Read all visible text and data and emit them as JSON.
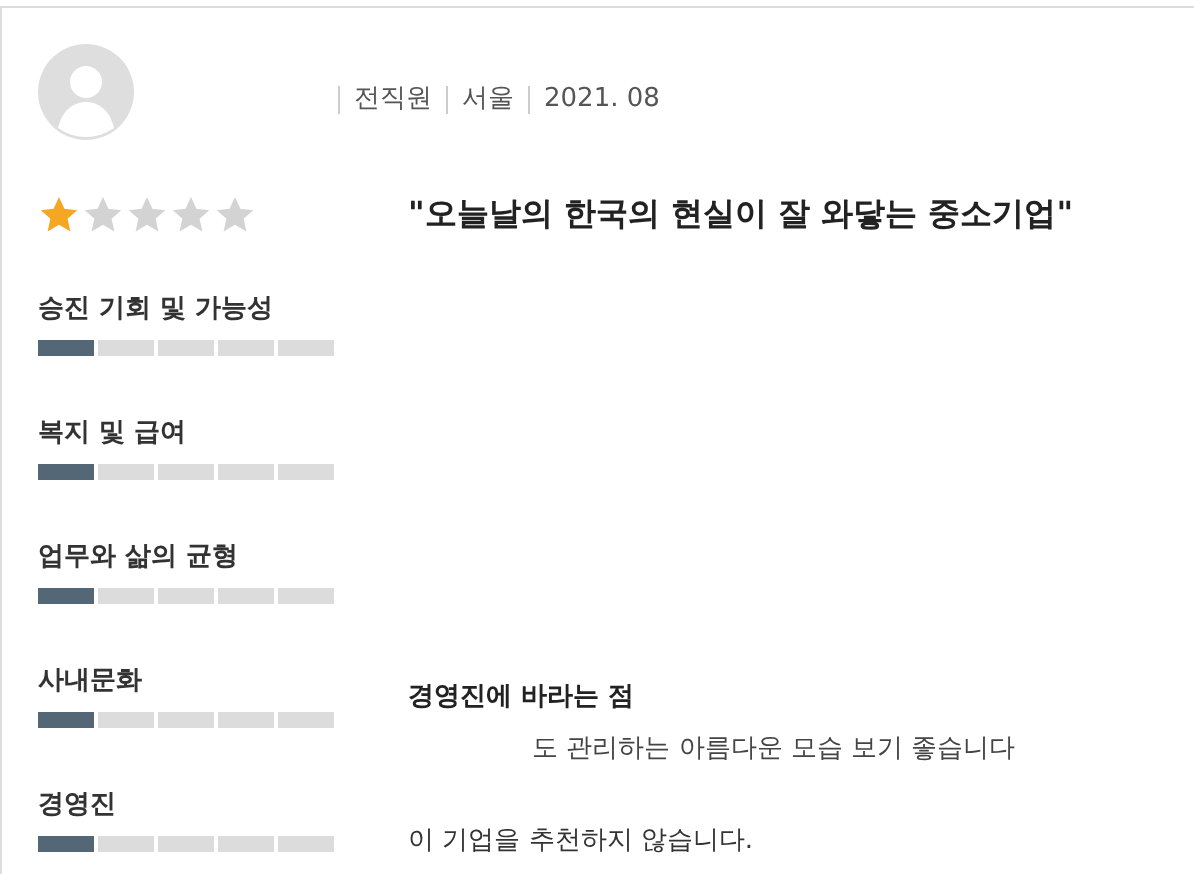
{
  "review": {
    "meta": [
      "전직원",
      "서울",
      "2021. 08"
    ],
    "stars": 1,
    "title": "\"오늘날의 한국의 현실이 잘 와닿는 중소기업\"",
    "categories": [
      {
        "label": "승진 기회 및 가능성",
        "level": 0.2
      },
      {
        "label": "복지 및 급여",
        "level": 0.2
      },
      {
        "label": "업무와 삶의 균형",
        "level": 0.2
      },
      {
        "label": "사내문화",
        "level": 0.2
      },
      {
        "label": "경영진",
        "level": 0.2
      }
    ],
    "wish_heading": "경영진에 바라는 점",
    "wish_text": "도 관리하는 아름다운 모습 보기 좋습니다",
    "recommendation": "이 기업을 추천하지 않습니다."
  }
}
